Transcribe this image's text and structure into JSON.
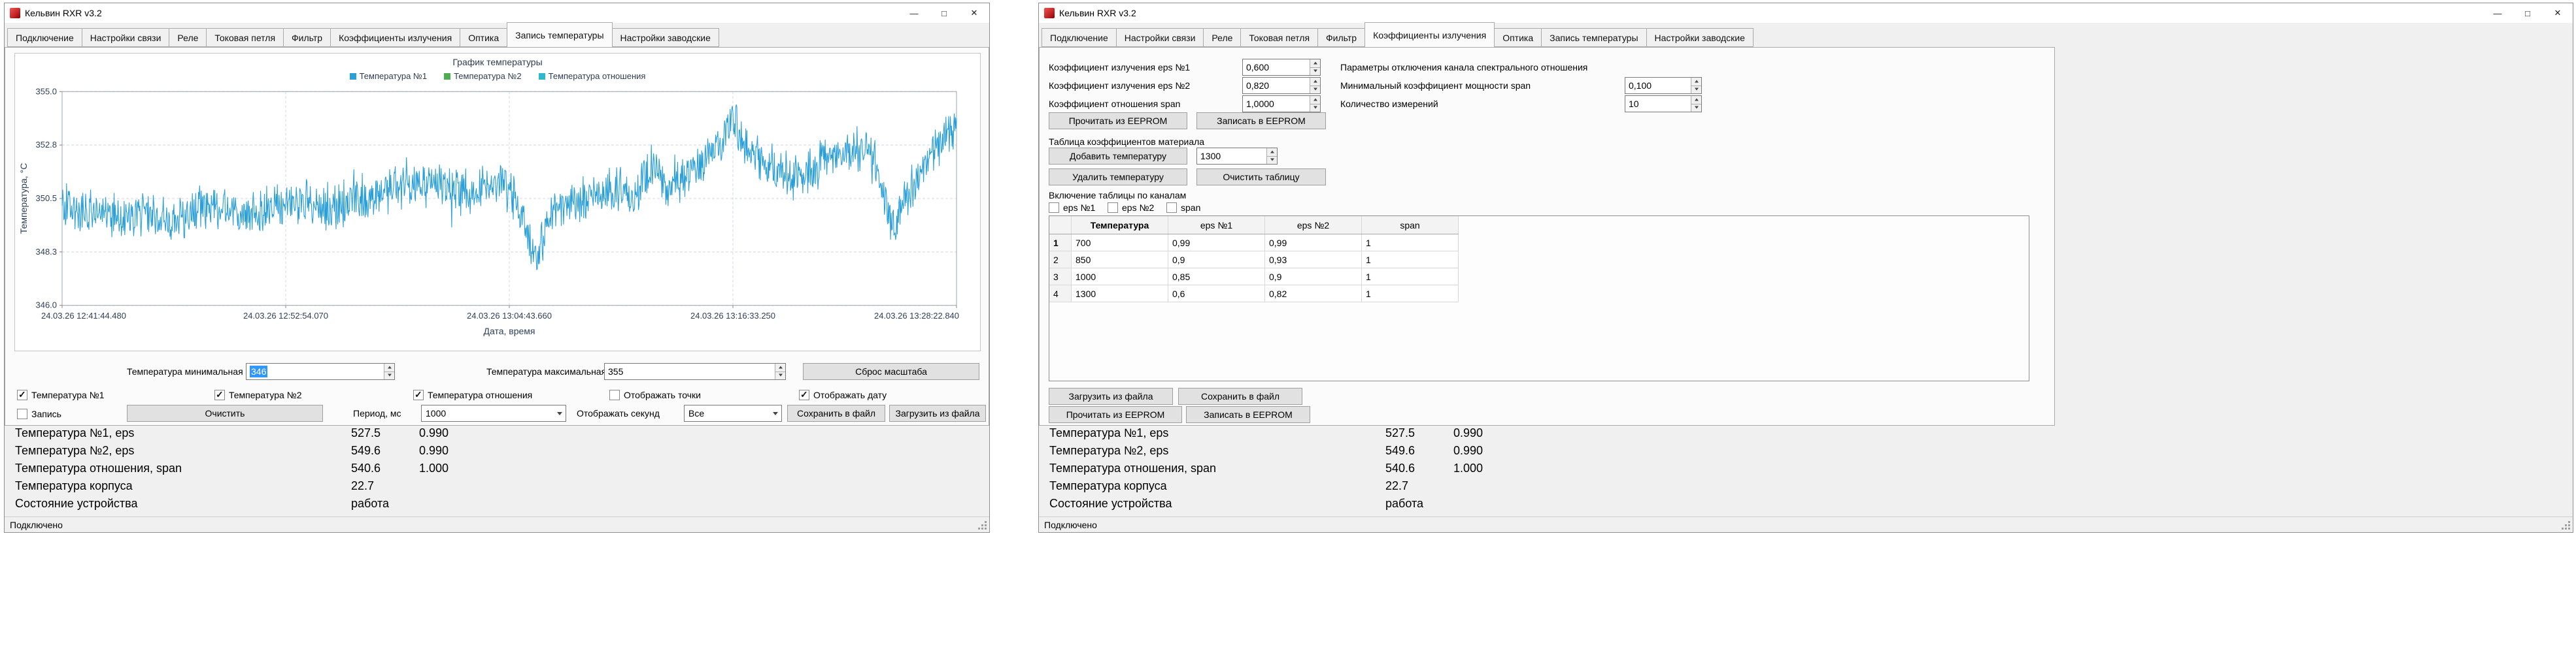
{
  "app": {
    "title": "Кельвин RXR v3.2",
    "status_bar": "Подключено",
    "window_buttons": {
      "minimize": "—",
      "maximize": "□",
      "close": "✕"
    }
  },
  "tabs": [
    "Подключение",
    "Настройки связи",
    "Реле",
    "Токовая петля",
    "Фильтр",
    "Коэффициенты излучения",
    "Оптика",
    "Запись температуры",
    "Настройки заводские"
  ],
  "chart_data": {
    "type": "line",
    "title": "График температуры",
    "xlabel": "Дата, время",
    "ylabel": "Температура, °C",
    "ylim": [
      346.0,
      355.0
    ],
    "yticks": [
      "355.0",
      "352.8",
      "350.5",
      "348.3",
      "346.0"
    ],
    "xticks": [
      "24.03.26 12:41:44.480",
      "24.03.26 12:52:54.070",
      "24.03.26 13:04:43.660",
      "24.03.26 13:16:33.250",
      "24.03.26 13:28:22.840"
    ],
    "grid": true,
    "legend_position": "top",
    "series": [
      {
        "name": "Температура №1",
        "color": "#2b9fd8",
        "visible": true,
        "points": 1600,
        "seed": 20240326,
        "noise": 0.85,
        "trend": [
          [
            0,
            350.3
          ],
          [
            0.02,
            349.8
          ],
          [
            0.045,
            350.1
          ],
          [
            0.07,
            349.7
          ],
          [
            0.095,
            349.9
          ],
          [
            0.12,
            349.6
          ],
          [
            0.15,
            350.0
          ],
          [
            0.18,
            350.2
          ],
          [
            0.21,
            349.8
          ],
          [
            0.24,
            350.1
          ],
          [
            0.27,
            350.4
          ],
          [
            0.3,
            350.1
          ],
          [
            0.33,
            350.4
          ],
          [
            0.36,
            350.8
          ],
          [
            0.39,
            351.0
          ],
          [
            0.42,
            351.2
          ],
          [
            0.445,
            350.7
          ],
          [
            0.47,
            350.9
          ],
          [
            0.495,
            351.2
          ],
          [
            0.515,
            349.6
          ],
          [
            0.53,
            347.6
          ],
          [
            0.545,
            349.9
          ],
          [
            0.565,
            350.2
          ],
          [
            0.59,
            350.5
          ],
          [
            0.615,
            350.8
          ],
          [
            0.64,
            350.6
          ],
          [
            0.66,
            352.0
          ],
          [
            0.675,
            351.0
          ],
          [
            0.695,
            351.3
          ],
          [
            0.715,
            351.9
          ],
          [
            0.735,
            352.8
          ],
          [
            0.75,
            354.0
          ],
          [
            0.762,
            352.9
          ],
          [
            0.775,
            352.3
          ],
          [
            0.795,
            351.7
          ],
          [
            0.815,
            351.4
          ],
          [
            0.84,
            351.8
          ],
          [
            0.86,
            352.1
          ],
          [
            0.88,
            352.4
          ],
          [
            0.9,
            352.6
          ],
          [
            0.915,
            351.2
          ],
          [
            0.93,
            349.4
          ],
          [
            0.945,
            350.6
          ],
          [
            0.96,
            351.6
          ],
          [
            0.975,
            352.6
          ],
          [
            0.99,
            353.2
          ],
          [
            1.0,
            353.6
          ]
        ]
      },
      {
        "name": "Температура №2",
        "color": "#4cae4f",
        "visible": false
      },
      {
        "name": "Температура отношения",
        "color": "#30b8d1",
        "visible": false
      }
    ]
  },
  "left_window": {
    "active_tab": "Запись температуры",
    "controls": {
      "temp_min_label": "Температура минимальная",
      "temp_min_value": "346",
      "temp_max_label": "Температура максимальная",
      "temp_max_value": "355",
      "reset_scale_button": "Сброс масштаба",
      "checkboxes": [
        {
          "label": "Температура №1",
          "checked": true
        },
        {
          "label": "Температура №2",
          "checked": true
        },
        {
          "label": "Температура отношения",
          "checked": true
        },
        {
          "label": "Отображать точки",
          "checked": false
        },
        {
          "label": "Отображать дату",
          "checked": true
        }
      ],
      "record_checkbox": {
        "label": "Запись",
        "checked": false
      },
      "clear_button": "Очистить",
      "period_label": "Период, мс",
      "period_value": "1000",
      "seconds_label": "Отображать секунд",
      "seconds_value": "Все",
      "save_button": "Сохранить в файл",
      "load_button": "Загрузить из файла"
    }
  },
  "right_window": {
    "active_tab": "Коэффициенты излучения",
    "emission": {
      "eps1_label": "Коэффициент излучения eps №1",
      "eps1_value": "0,600",
      "eps2_label": "Коэффициент излучения eps №2",
      "eps2_value": "0,820",
      "span_label": "Коэффициент отношения span",
      "span_value": "1,0000",
      "read_eeprom_button": "Прочитать из EEPROM",
      "write_eeprom_button": "Записать в EEPROM",
      "spectral_group_label": "Параметры отключения канала спектрального отношения",
      "min_power_label": "Минимальный коэффициент мощности span",
      "min_power_value": "0,100",
      "measure_count_label": "Количество измерений",
      "measure_count_value": "10",
      "material_table_label": "Таблица коэффициентов материала",
      "add_temp_button": "Добавить температуру",
      "add_temp_value": "1300",
      "delete_temp_button": "Удалить температуру",
      "clear_table_button": "Очистить таблицу",
      "channels_label": "Включение таблицы по каналам",
      "channel_checkboxes": [
        {
          "label": "eps №1",
          "checked": false
        },
        {
          "label": "eps №2",
          "checked": false
        },
        {
          "label": "span",
          "checked": false
        }
      ],
      "table": {
        "columns": [
          "Температура",
          "eps №1",
          "eps №2",
          "span"
        ],
        "rows": [
          [
            "700",
            "0,99",
            "0,99",
            "1"
          ],
          [
            "850",
            "0,9",
            "0,93",
            "1"
          ],
          [
            "1000",
            "0,85",
            "0,9",
            "1"
          ],
          [
            "1300",
            "0,6",
            "0,82",
            "1"
          ]
        ]
      },
      "load_file_button": "Загрузить из файла",
      "save_file_button": "Сохранить в файл",
      "read_eeprom2_button": "Прочитать из EEPROM",
      "write_eeprom2_button": "Записать в EEPROM"
    }
  },
  "status_readout": [
    {
      "label": "Температура №1, eps",
      "value1": "527.5",
      "value2": "0.990"
    },
    {
      "label": "Температура №2, eps",
      "value1": "549.6",
      "value2": "0.990"
    },
    {
      "label": "Температура отношения, span",
      "value1": "540.6",
      "value2": "1.000"
    },
    {
      "label": "Температура корпуса",
      "value1": "22.7",
      "value2": ""
    },
    {
      "label": "Состояние устройства",
      "value1": "работа",
      "value2": ""
    }
  ]
}
